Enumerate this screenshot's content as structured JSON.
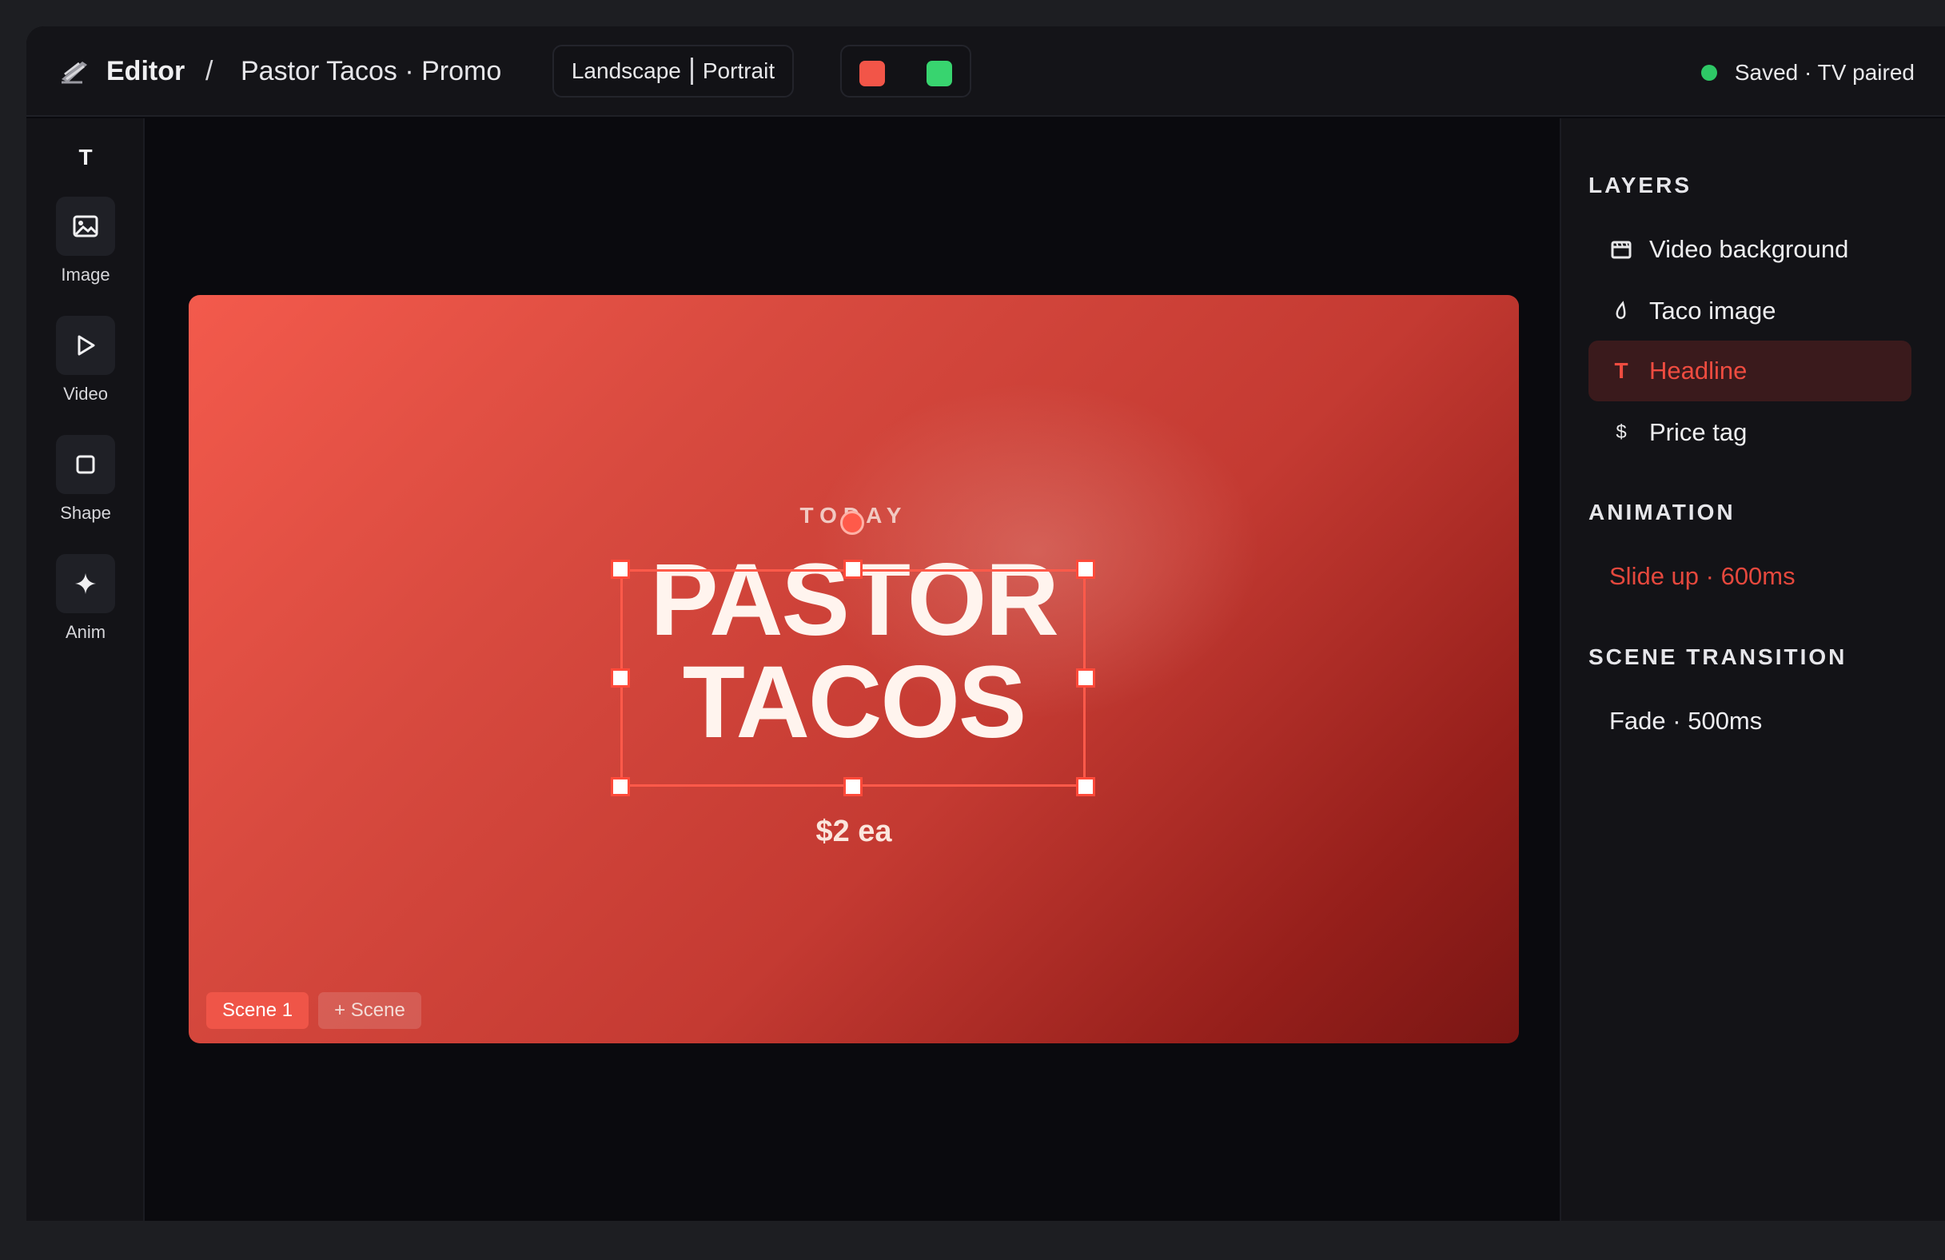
{
  "header": {
    "app_name": "Editor",
    "separator": "/",
    "project_name": "Pastor Tacos · Promo",
    "orientation": {
      "landscape": "Landscape",
      "portrait": "Portrait"
    },
    "swatches": [
      "#f25548",
      "#38d46f"
    ],
    "status_text": "Saved · TV paired",
    "status_color": "#2ec866"
  },
  "tools": [
    {
      "label": "Text",
      "icon": "text-icon",
      "active": true
    },
    {
      "label": "Image",
      "icon": "image-icon"
    },
    {
      "label": "Video",
      "icon": "play-icon"
    },
    {
      "label": "Shape",
      "icon": "square-icon"
    },
    {
      "label": "Anim",
      "icon": "sparkle-icon"
    }
  ],
  "tool_glyphs": {
    "text": "T"
  },
  "canvas": {
    "kicker": "TODAY",
    "headline_line1": "PASTOR",
    "headline_line2": "TACOS",
    "price": "$2 ea",
    "scenes": {
      "current": "Scene 1",
      "add": "+ Scene"
    }
  },
  "panel": {
    "layers_title": "LAYERS",
    "layers": [
      {
        "label": "Video background",
        "icon": "film-icon"
      },
      {
        "label": "Taco image",
        "icon": "drop-icon"
      },
      {
        "label": "Headline",
        "icon": "text-icon",
        "glyph": "T",
        "active": true
      },
      {
        "label": "Price tag",
        "icon": "dollar-icon",
        "glyph": "$"
      }
    ],
    "animation_title": "ANIMATION",
    "animation_value": "Slide up · 600ms",
    "transition_title": "SCENE TRANSITION",
    "transition_value": "Fade · 500ms"
  },
  "colors": {
    "accent": "#ef4c40",
    "selection": "#ff5a4a"
  }
}
